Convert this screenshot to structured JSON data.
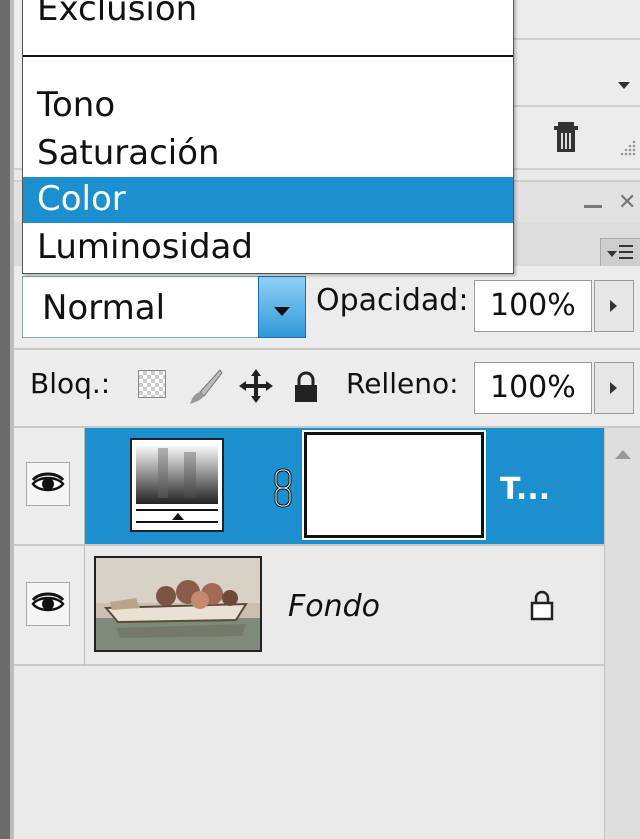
{
  "blend_menu": {
    "items": [
      "Exclusión",
      "Tono",
      "Saturación",
      "Color",
      "Luminosidad"
    ],
    "selected": "Color"
  },
  "layers_panel": {
    "blend_mode": "Normal",
    "opacity_label": "Opacidad:",
    "opacity_value": "100%",
    "lock_label": "Bloq.:",
    "fill_label": "Relleno:",
    "fill_value": "100%",
    "layers": [
      {
        "name": "T...",
        "selected": true,
        "visible": true
      },
      {
        "name": "Fondo",
        "selected": false,
        "visible": true,
        "locked": true
      }
    ]
  },
  "colors": {
    "selection": "#1c8fcf",
    "panel_bg": "#ececec"
  }
}
